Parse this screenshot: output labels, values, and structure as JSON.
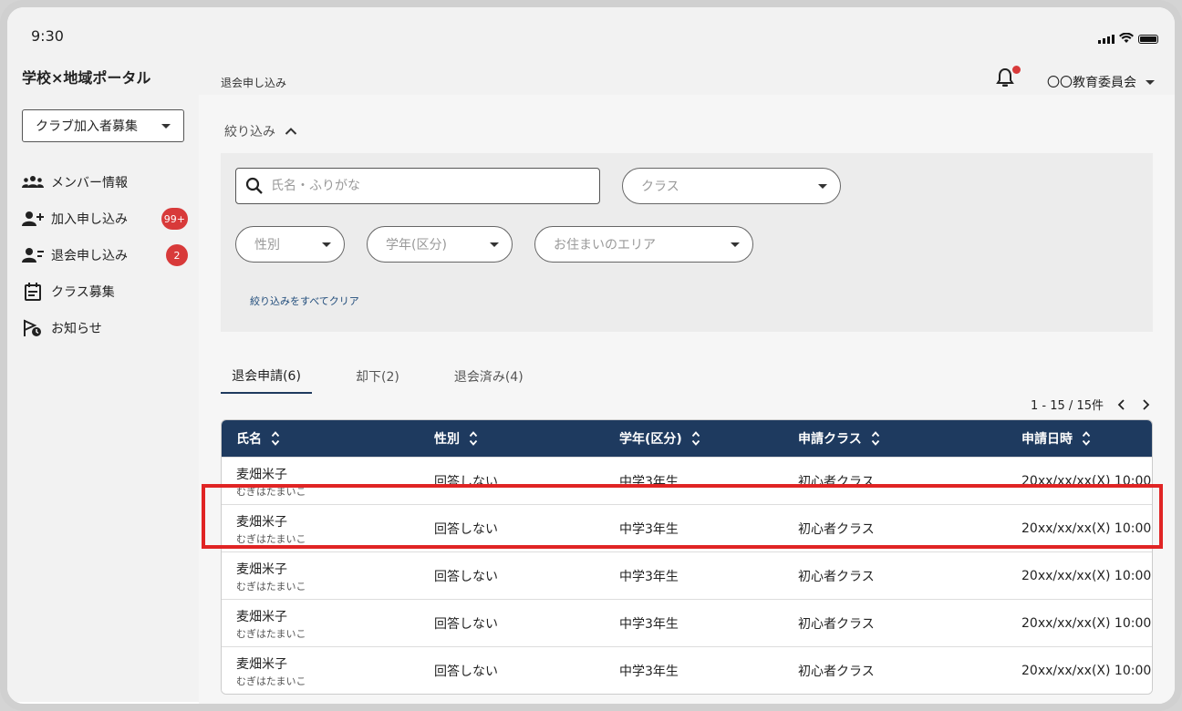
{
  "status": {
    "time": "9:30"
  },
  "app": {
    "brand": "学校×地域ポータル"
  },
  "sidebar": {
    "club_select": "クラブ加入者募集",
    "items": [
      {
        "label": "メンバー情報",
        "icon": "members-icon",
        "badge": ""
      },
      {
        "label": "加入申し込み",
        "icon": "add-person-icon",
        "badge": "99+"
      },
      {
        "label": "退会申し込み",
        "icon": "remove-person-icon",
        "badge": "2"
      },
      {
        "label": "クラス募集",
        "icon": "calendar-icon",
        "badge": ""
      },
      {
        "label": "お知らせ",
        "icon": "announcement-icon",
        "badge": ""
      }
    ]
  },
  "header": {
    "breadcrumb": "退会申し込み",
    "org": "〇〇教育委員会"
  },
  "filter": {
    "toggle_label": "絞り込み",
    "search_placeholder": "氏名・ふりがな",
    "class_placeholder": "クラス",
    "gender_placeholder": "性別",
    "grade_placeholder": "学年(区分)",
    "area_placeholder": "お住まいのエリア",
    "clear_label": "絞り込みをすべてクリア"
  },
  "tabs": [
    {
      "label": "退会申請(6)",
      "active": true
    },
    {
      "label": "却下(2)",
      "active": false
    },
    {
      "label": "退会済み(4)",
      "active": false
    }
  ],
  "paging": {
    "text": "1 - 15 / 15件"
  },
  "table": {
    "columns": [
      "氏名",
      "性別",
      "学年(区分)",
      "申請クラス",
      "申請日時"
    ],
    "rows": [
      {
        "name": "麦畑米子",
        "kana": "むぎはたまいこ",
        "gender": "回答しない",
        "grade": "中学3年生",
        "class": "初心者クラス",
        "date": "20xx/xx/xx(X) 10:00"
      },
      {
        "name": "麦畑米子",
        "kana": "むぎはたまいこ",
        "gender": "回答しない",
        "grade": "中学3年生",
        "class": "初心者クラス",
        "date": "20xx/xx/xx(X) 10:00"
      },
      {
        "name": "麦畑米子",
        "kana": "むぎはたまいこ",
        "gender": "回答しない",
        "grade": "中学3年生",
        "class": "初心者クラス",
        "date": "20xx/xx/xx(X) 10:00"
      },
      {
        "name": "麦畑米子",
        "kana": "むぎはたまいこ",
        "gender": "回答しない",
        "grade": "中学3年生",
        "class": "初心者クラス",
        "date": "20xx/xx/xx(X) 10:00"
      },
      {
        "name": "麦畑米子",
        "kana": "むぎはたまいこ",
        "gender": "回答しない",
        "grade": "中学3年生",
        "class": "初心者クラス",
        "date": "20xx/xx/xx(X) 10:00"
      }
    ]
  },
  "colors": {
    "header_bg": "#1e3a5f",
    "badge": "#d83a3a",
    "highlight": "#e02424"
  }
}
